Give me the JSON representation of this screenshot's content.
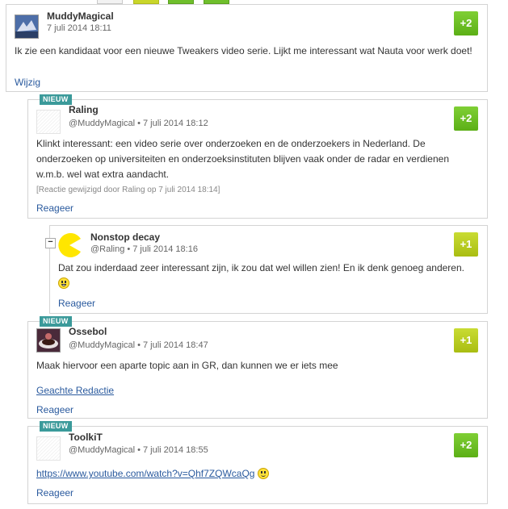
{
  "comments": [
    {
      "author": "MuddyMagical",
      "timestamp": "7 juli 2014 18:11",
      "text": "Ik zie een kandidaat voor een nieuwe Tweakers video serie. Lijkt me interessant wat Nauta voor werk doet!",
      "action": "Wijzig",
      "score": "+2"
    },
    {
      "badge": "NIEUW",
      "author": "Raling",
      "reply_to": "@MuddyMagical",
      "timestamp": "7 juli 2014 18:12",
      "text": "Klinkt interessant: een video serie over onderzoeken en de onderzoekers in Nederland. De onderzoeken op universiteiten en onderzoeksinstituten blijven vaak onder de radar en verdienen w.m.b. wel wat extra aandacht.",
      "edited": "[Reactie gewijzigd door Raling op 7 juli 2014 18:14]",
      "action": "Reageer",
      "score": "+2"
    },
    {
      "collapse": "−",
      "author": "Nonstop decay",
      "reply_to": "@Raling",
      "timestamp": "7 juli 2014 18:16",
      "text": "Dat zou inderdaad zeer interessant zijn, ik zou dat wel willen zien! En ik denk genoeg anderen.",
      "action": "Reageer",
      "score": "+1"
    },
    {
      "badge": "NIEUW",
      "author": "Ossebol",
      "reply_to": "@MuddyMagical",
      "timestamp": "7 juli 2014 18:47",
      "text": "Maak hiervoor een aparte topic aan in GR, dan kunnen we er iets mee",
      "link": "Geachte Redactie",
      "action": "Reageer",
      "score": "+1"
    },
    {
      "badge": "NIEUW",
      "author": "ToolkiT",
      "reply_to": "@MuddyMagical",
      "timestamp": "7 juli 2014 18:55",
      "link": "https://www.youtube.com/watch?v=Qhf7ZQWcaQg",
      "action": "Reageer",
      "score": "+2"
    }
  ],
  "meta_separator": "•",
  "colors": {
    "score_green": "#6bbd22",
    "score_yellow": "#b8cc1e",
    "link": "#2a5a9e",
    "badge": "#3b9a9a"
  }
}
